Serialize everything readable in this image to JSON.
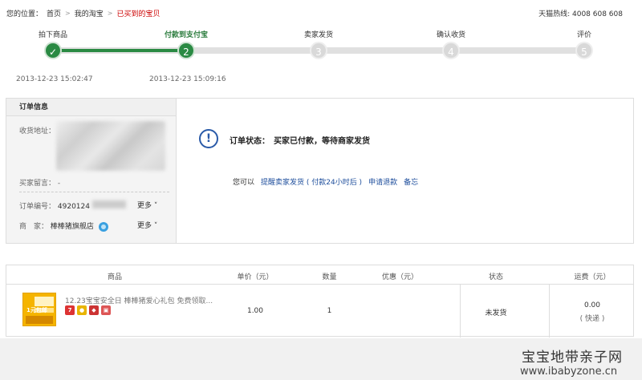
{
  "breadcrumb": {
    "prefix": "您的位置：",
    "items": [
      "首页",
      "我的淘宝"
    ],
    "current": "已买到的宝贝"
  },
  "hotline": "天猫热线: 4008 608 608",
  "steps": [
    {
      "label": "拍下商品",
      "num": "✓",
      "state": "done",
      "time": "2013-12-23 15:02:47"
    },
    {
      "label": "付款到支付宝",
      "num": "2",
      "state": "current",
      "time": "2013-12-23 15:09:16"
    },
    {
      "label": "卖家发货",
      "num": "3",
      "state": "todo",
      "time": ""
    },
    {
      "label": "确认收货",
      "num": "4",
      "state": "todo",
      "time": ""
    },
    {
      "label": "评价",
      "num": "5",
      "state": "todo",
      "time": ""
    }
  ],
  "order_info": {
    "title": "订单信息",
    "address_label": "收货地址：",
    "message_label": "买家留言：",
    "message_value": "-",
    "order_no_label": "订单编号：",
    "order_no_value": "4920124",
    "more1": "更多",
    "seller_label": "商　家：",
    "seller_value": "棒棒猪旗舰店",
    "more2": "更多"
  },
  "status": {
    "icon": "info-icon",
    "text": "订单状态：　买家已付款，等待商家发货",
    "actions_label": "您可以",
    "actions": [
      "提醒卖家发货 ( 付款24小时后 )",
      "申请退款",
      "备忘"
    ]
  },
  "table": {
    "headers": [
      "商品",
      "单价（元）",
      "数量",
      "优惠（元）",
      "状态",
      "运费（元）"
    ],
    "row": {
      "title": "12.23宝宝安全日 棒棒猪爱心礼包 免费领取...",
      "price": "1.00",
      "qty": "1",
      "discount": "",
      "status": "未发货",
      "shipping": "0.00",
      "shipping_method": "( 快递 )",
      "image_text": "1元包邮"
    }
  },
  "watermark": {
    "line1": "宝宝地带亲子网",
    "line2": "www.ibabyzone.cn"
  },
  "colors": {
    "accent_green": "#2a8a43",
    "link_blue": "#1e4e9c",
    "breadcrumb_current": "#cc0000"
  }
}
